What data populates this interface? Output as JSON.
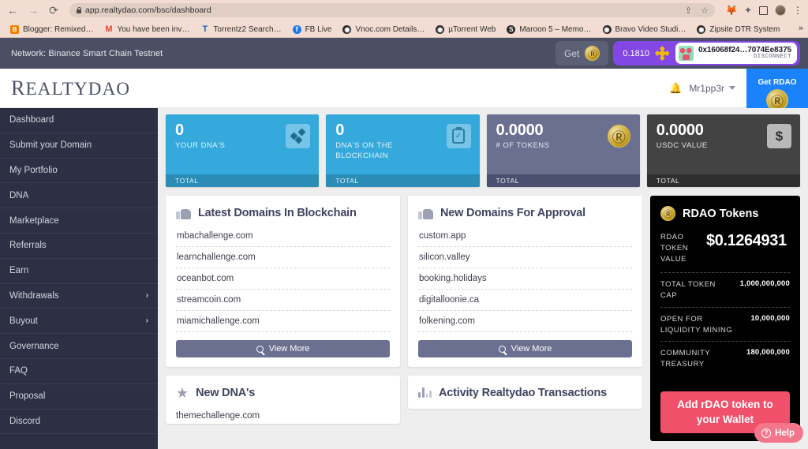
{
  "browser": {
    "url": "app.realtydao.com/bsc/dashboard",
    "nav": {
      "back": "←",
      "forward": "→",
      "reload": "C"
    },
    "omnibox_icons": {
      "lock": "lock-icon",
      "share": "⇪",
      "star": "☆"
    },
    "toolbar_icons": {
      "metamask": "🦊",
      "extensions": "✦",
      "sidepanel": "▣",
      "profile": "avatar",
      "menu": "⋮"
    },
    "bookmarks": [
      {
        "label": "Blogger: Remixed…",
        "icon": "B"
      },
      {
        "label": "You have been inv…",
        "icon": "M"
      },
      {
        "label": "Torrentz2 Search…",
        "icon": "T"
      },
      {
        "label": "FB Live",
        "icon": "f"
      },
      {
        "label": "Vnoc.com Details…",
        "icon": "◉"
      },
      {
        "label": "µTorrent Web",
        "icon": "◉"
      },
      {
        "label": "Maroon 5 – Memo…",
        "icon": "S"
      },
      {
        "label": "Bravo Video Studi…",
        "icon": "◉"
      },
      {
        "label": "Zipsite DTR System",
        "icon": "◉"
      }
    ],
    "bookmarks_overflow": "»"
  },
  "network_bar": {
    "network_text": "Network: Binance Smart Chain Testnet",
    "get_label": "Get",
    "balance": "0.1810",
    "address": "0x16068f24…7074Ee8375",
    "disconnect_label": "DISCONNECT"
  },
  "app_header": {
    "brand_first": "R",
    "brand_rest": "EALTYDAO",
    "username": "Mr1pp3r",
    "get_rdao_label": "Get RDAO"
  },
  "sidebar": {
    "items": [
      {
        "label": "Dashboard",
        "chevron": ""
      },
      {
        "label": "Submit your Domain",
        "chevron": ""
      },
      {
        "label": "My Portfolio",
        "chevron": ""
      },
      {
        "label": "DNA",
        "chevron": ""
      },
      {
        "label": "Marketplace",
        "chevron": ""
      },
      {
        "label": "Referrals",
        "chevron": ""
      },
      {
        "label": "Earn",
        "chevron": ""
      },
      {
        "label": "Withdrawals",
        "chevron": "›"
      },
      {
        "label": "Buyout",
        "chevron": "›"
      },
      {
        "label": "Governance",
        "chevron": ""
      },
      {
        "label": "FAQ",
        "chevron": ""
      },
      {
        "label": "Proposal",
        "chevron": ""
      },
      {
        "label": "Discord",
        "chevron": ""
      }
    ]
  },
  "stats": [
    {
      "value": "0",
      "label": "YOUR DNA'S",
      "footer": "TOTAL",
      "theme": "c-blue",
      "icon": "dna-icon"
    },
    {
      "value": "0",
      "label": "DNA'S ON THE BLOCKCHAIN",
      "footer": "TOTAL",
      "theme": "c-blue",
      "icon": "clipboard-check-icon"
    },
    {
      "value": "0.0000",
      "label": "# OF TOKENS",
      "footer": "TOTAL",
      "theme": "c-purple",
      "icon": "rdao-coin-icon"
    },
    {
      "value": "0.0000",
      "label": "USDC VALUE",
      "footer": "TOTAL",
      "theme": "c-dark",
      "icon": "dollar-icon"
    }
  ],
  "panels": {
    "latest_domains": {
      "title": "Latest Domains In Blockchain",
      "icon": "thumbs-up-icon",
      "rows": [
        "mbachallenge.com",
        "learnchallenge.com",
        "oceanbot.com",
        "streamcoin.com",
        "miamichallenge.com"
      ],
      "view_more": "View More"
    },
    "new_domains": {
      "title": "New Domains For Approval",
      "icon": "thumbs-up-icon",
      "rows": [
        "custom.app",
        "silicon.valley",
        "booking.holidays",
        "digitalloonie.ca",
        "folkening.com"
      ],
      "view_more": "View More"
    },
    "new_dnas": {
      "title": "New DNA's",
      "icon": "star-icon",
      "first_row": "themechallenge.com"
    },
    "activity": {
      "title": "Activity Realtydao Transactions",
      "icon": "bar-chart-icon"
    }
  },
  "token_card": {
    "title": "RDAO Tokens",
    "icon": "rdao-coin-icon",
    "value_label": "RDAO TOKEN VALUE",
    "value": "$0.1264931",
    "rows": [
      {
        "key": "TOTAL TOKEN CAP",
        "value": "1,000,000,000"
      },
      {
        "key": "OPEN FOR LIQUIDITY MINING",
        "value": "10,000,000"
      },
      {
        "key": "COMMUNITY TREASURY",
        "value": "180,000,000"
      }
    ],
    "cta": "Add rDAO token to your Wallet"
  },
  "help": {
    "label": "Help",
    "icon": "question-circle-icon"
  },
  "colors": {
    "sidebar": "#2c3044",
    "network_bar": "#4a4f63",
    "accent_blue": "#35a9dc",
    "purple": "#6b6f90",
    "dark": "#434343",
    "cta_red": "#f0506a",
    "get_rdao_blue": "#1a82fb",
    "page_bg": "#eeeeee"
  }
}
